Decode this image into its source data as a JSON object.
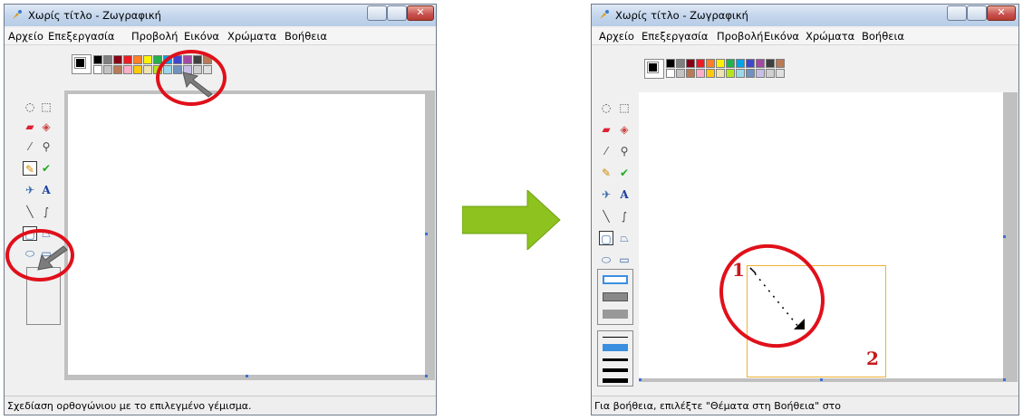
{
  "window_title": "Χωρίς τίτλο - Ζωγραφική",
  "menu": [
    "Αρχείο",
    "Επεξεργασία",
    "Προβολή",
    "Εικόνα",
    "Χρώματα",
    "Βοήθεια"
  ],
  "palette": {
    "top_row": [
      "#000000",
      "#7f7f7f",
      "#880015",
      "#ed1c24",
      "#ff7f27",
      "#fff200",
      "#22b14c",
      "#00a2e8",
      "#3f48cc",
      "#a349a4",
      "#404040",
      "#b97a57"
    ],
    "bottom_row": [
      "#ffffff",
      "#c3c3c3",
      "#b97a57",
      "#ffaec9",
      "#ffc90e",
      "#efe4b0",
      "#b5e61d",
      "#99d9ea",
      "#7092be",
      "#c8bfe7",
      "#d0d0d0",
      "#e0e0e0"
    ]
  },
  "left_window": {
    "status_text": "Σχεδίαση ορθογώνιου με το επιλεγμένο γέμισμα."
  },
  "right_window": {
    "status_text": "Για βοήθεια, επιλέξτε \"Θέματα στη Βοήθεια\" στο",
    "annotation_1": "1",
    "annotation_2": "2"
  },
  "icons": [
    "paint-app-icon",
    "free-select-icon",
    "rect-select-icon",
    "eraser-icon",
    "fill-bucket-icon",
    "color-picker-icon",
    "magnifier-icon",
    "pencil-icon",
    "brush-icon",
    "airbrush-icon",
    "text-icon",
    "line-icon",
    "curve-icon",
    "rectangle-icon",
    "polygon-icon",
    "ellipse-icon",
    "rounded-rect-icon",
    "arrow-right-icon",
    "mouse-pointer-icon"
  ],
  "colors": {
    "arrow_green": "#8dc21f",
    "annotation_red": "#e0101a",
    "selection_rect": "#f0b030"
  }
}
